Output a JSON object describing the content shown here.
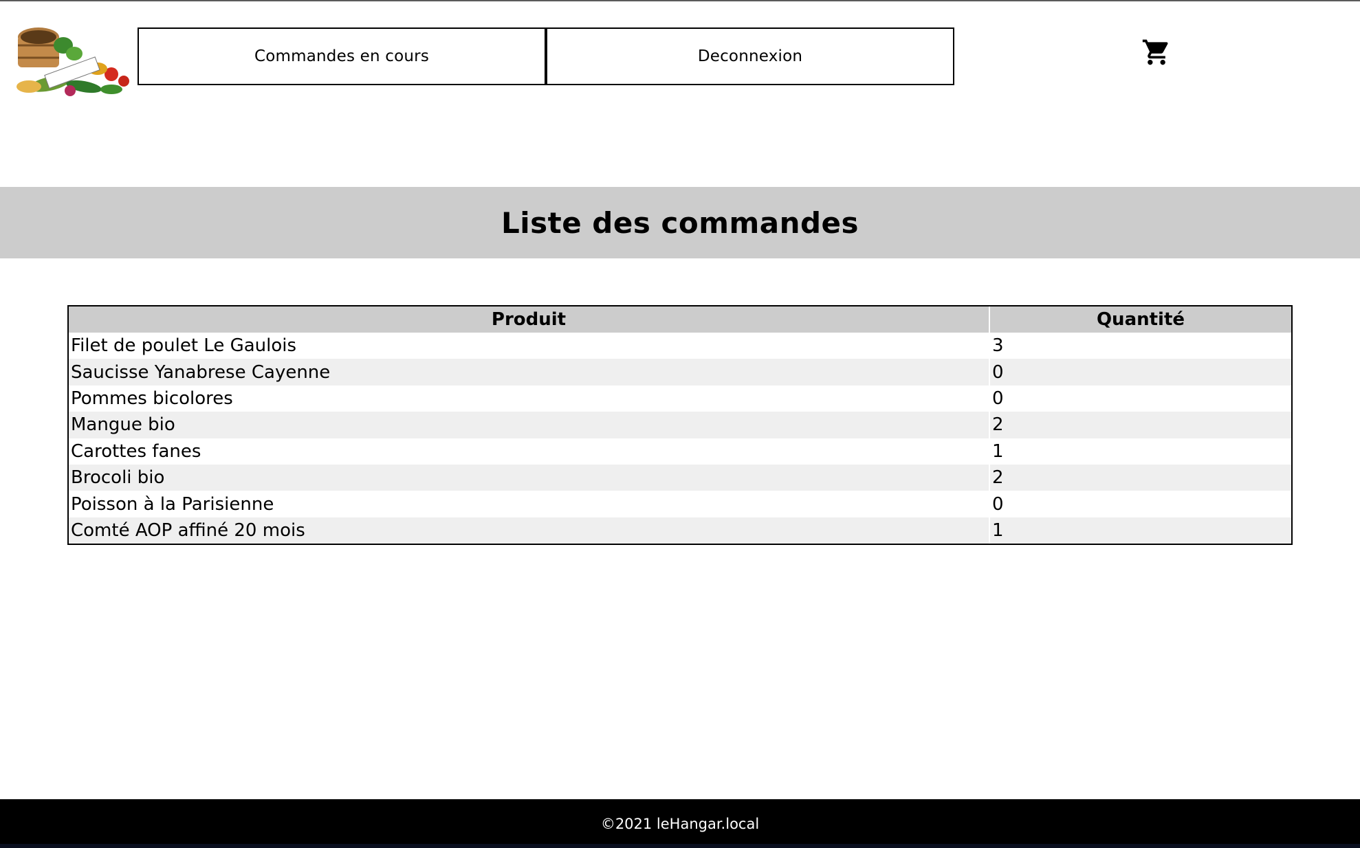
{
  "header": {
    "logo": {
      "text": "leHangar.local",
      "icon": "vegetable-basket-logo"
    },
    "nav": {
      "orders_label": "Commandes en cours",
      "logout_label": "Deconnexion"
    },
    "cart_icon": "shopping-cart-icon"
  },
  "main": {
    "title": "Liste des commandes",
    "table": {
      "columns": [
        "Produit",
        "Quantité"
      ],
      "rows": [
        {
          "product": "Filet de poulet Le Gaulois",
          "quantity": "3"
        },
        {
          "product": "Saucisse Yanabrese Cayenne",
          "quantity": "0"
        },
        {
          "product": "Pommes bicolores",
          "quantity": "0"
        },
        {
          "product": "Mangue bio",
          "quantity": "2"
        },
        {
          "product": "Carottes fanes",
          "quantity": "1"
        },
        {
          "product": "Brocoli bio",
          "quantity": "2"
        },
        {
          "product": "Poisson à la Parisienne",
          "quantity": "0"
        },
        {
          "product": "Comté AOP affiné 20 mois",
          "quantity": "1"
        }
      ]
    }
  },
  "footer": {
    "text": "©2021 leHangar.local"
  },
  "colors": {
    "band_gray": "#cccccc",
    "row_stripe": "#efefef",
    "footer_bg": "#000000"
  }
}
